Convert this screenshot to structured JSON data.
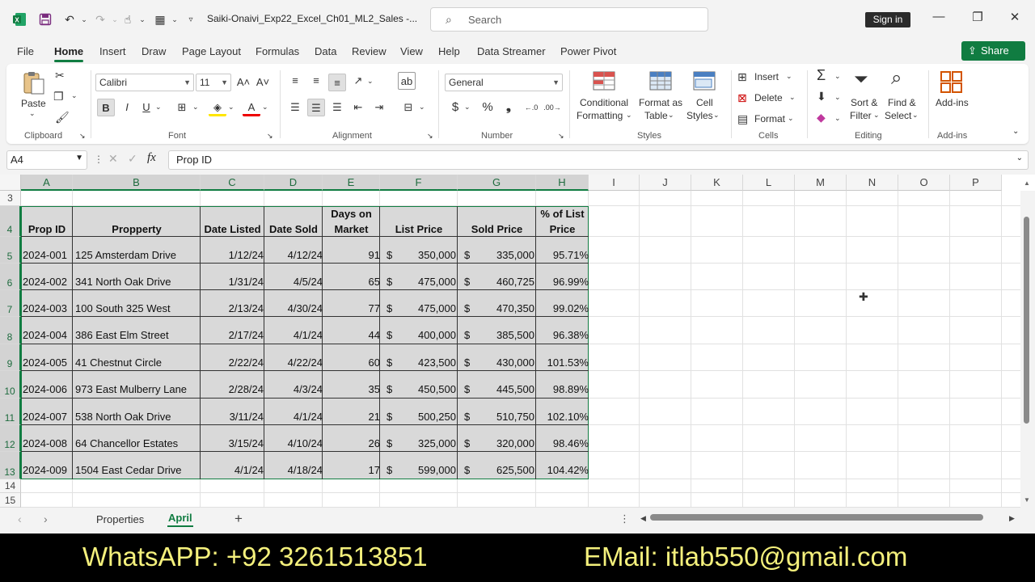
{
  "titlebar": {
    "doc_title": "Saiki-Onaivi_Exp22_Excel_Ch01_ML2_Sales  -...",
    "search_placeholder": "Search",
    "sign_in": "Sign in"
  },
  "menu": {
    "tabs": [
      "File",
      "Home",
      "Insert",
      "Draw",
      "Page Layout",
      "Formulas",
      "Data",
      "Review",
      "View",
      "Help",
      "Data Streamer",
      "Power Pivot"
    ],
    "active": "Home",
    "share_label": "Share"
  },
  "ribbon": {
    "clipboard": {
      "label": "Clipboard",
      "paste": "Paste"
    },
    "font": {
      "label": "Font",
      "font_name": "Calibri",
      "font_size": "11"
    },
    "alignment": {
      "label": "Alignment"
    },
    "number": {
      "label": "Number",
      "format": "General"
    },
    "styles": {
      "label": "Styles",
      "conditional_1": "Conditional",
      "conditional_2": "Formatting",
      "format_table_1": "Format as",
      "format_table_2": "Table",
      "cell_styles_1": "Cell",
      "cell_styles_2": "Styles"
    },
    "cells": {
      "label": "Cells",
      "insert": "Insert",
      "delete": "Delete",
      "format": "Format"
    },
    "editing": {
      "label": "Editing",
      "sort_1": "Sort &",
      "sort_2": "Filter",
      "find_1": "Find &",
      "find_2": "Select"
    },
    "addins": {
      "label": "Add-ins",
      "button": "Add-ins"
    }
  },
  "formula_bar": {
    "name_box": "A4",
    "formula": "Prop ID"
  },
  "grid": {
    "columns": [
      "A",
      "B",
      "C",
      "D",
      "E",
      "F",
      "G",
      "H",
      "I",
      "J",
      "K",
      "L",
      "M",
      "N",
      "O",
      "P"
    ],
    "rows": [
      "3",
      "4",
      "5",
      "6",
      "7",
      "8",
      "9",
      "10",
      "11",
      "12",
      "13",
      "14",
      "15"
    ],
    "headers": {
      "prop_id": "Prop ID",
      "property": "Propperty",
      "date_listed": "Date Listed",
      "date_sold": "Date Sold",
      "days_1": "Days on",
      "days_2": "Market",
      "list_price": "List Price",
      "sold_price": "Sold Price",
      "pct_1": "% of List",
      "pct_2": "Price"
    },
    "currency": "$",
    "records": [
      {
        "id": "2024-001",
        "property": "125 Amsterdam Drive",
        "listed": "1/12/24",
        "sold": "4/12/24",
        "days": "91",
        "list": "350,000",
        "soldp": "335,000",
        "pct": "95.71%"
      },
      {
        "id": "2024-002",
        "property": "341 North Oak Drive",
        "listed": "1/31/24",
        "sold": "4/5/24",
        "days": "65",
        "list": "475,000",
        "soldp": "460,725",
        "pct": "96.99%"
      },
      {
        "id": "2024-003",
        "property": "100 South 325 West",
        "listed": "2/13/24",
        "sold": "4/30/24",
        "days": "77",
        "list": "475,000",
        "soldp": "470,350",
        "pct": "99.02%"
      },
      {
        "id": "2024-004",
        "property": "386 East Elm Street",
        "listed": "2/17/24",
        "sold": "4/1/24",
        "days": "44",
        "list": "400,000",
        "soldp": "385,500",
        "pct": "96.38%"
      },
      {
        "id": "2024-005",
        "property": "41 Chestnut Circle",
        "listed": "2/22/24",
        "sold": "4/22/24",
        "days": "60",
        "list": "423,500",
        "soldp": "430,000",
        "pct": "101.53%"
      },
      {
        "id": "2024-006",
        "property": "973 East Mulberry Lane",
        "listed": "2/28/24",
        "sold": "4/3/24",
        "days": "35",
        "list": "450,500",
        "soldp": "445,500",
        "pct": "98.89%"
      },
      {
        "id": "2024-007",
        "property": "538 North Oak Drive",
        "listed": "3/11/24",
        "sold": "4/1/24",
        "days": "21",
        "list": "500,250",
        "soldp": "510,750",
        "pct": "102.10%"
      },
      {
        "id": "2024-008",
        "property": "64 Chancellor Estates",
        "listed": "3/15/24",
        "sold": "4/10/24",
        "days": "26",
        "list": "325,000",
        "soldp": "320,000",
        "pct": "98.46%"
      },
      {
        "id": "2024-009",
        "property": "1504 East Cedar Drive",
        "listed": "4/1/24",
        "sold": "4/18/24",
        "days": "17",
        "list": "599,000",
        "soldp": "625,500",
        "pct": "104.42%"
      }
    ]
  },
  "sheets": {
    "tabs": [
      "Properties",
      "April"
    ],
    "active": "April"
  },
  "overlay": {
    "whatsapp": "WhatsAPP: +92 3261513851",
    "email": "EMail: itlab550@gmail.com"
  },
  "colors": {
    "accent": "#107c41",
    "overlay_text": "#f4f07c"
  }
}
